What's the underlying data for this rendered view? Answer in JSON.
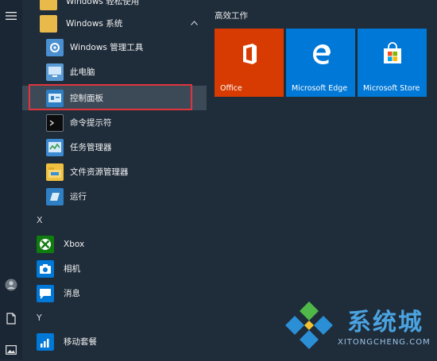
{
  "list": {
    "cut_top_label": "Windows 轻松使用",
    "group": {
      "label": "Windows 系统",
      "chevron": "up"
    },
    "items": [
      {
        "label": "Windows 管理工具",
        "icon": "admin-tools-icon"
      },
      {
        "label": "此电脑",
        "icon": "this-pc-icon"
      },
      {
        "label": "控制面板",
        "icon": "control-panel-icon",
        "selected": true
      },
      {
        "label": "命令提示符",
        "icon": "cmd-icon"
      },
      {
        "label": "任务管理器",
        "icon": "task-manager-icon"
      },
      {
        "label": "文件资源管理器",
        "icon": "file-explorer-icon"
      },
      {
        "label": "运行",
        "icon": "run-icon"
      }
    ],
    "letter_x": "X",
    "x_items": [
      {
        "label": "Xbox",
        "icon": "xbox-icon"
      },
      {
        "label": "相机",
        "icon": "camera-icon"
      },
      {
        "label": "消息",
        "icon": "messaging-icon"
      }
    ],
    "letter_y": "Y",
    "y_items": [
      {
        "label": "移动套餐",
        "icon": "mobile-plans-icon"
      }
    ]
  },
  "tiles": {
    "group_title": "高效工作",
    "items": [
      {
        "label": "Office",
        "color": "#d83b01",
        "icon": "office-icon"
      },
      {
        "label": "Microsoft Edge",
        "color": "#0078d7",
        "icon": "edge-icon"
      },
      {
        "label": "Microsoft Store",
        "color": "#0078d7",
        "icon": "store-icon"
      }
    ]
  },
  "watermark": {
    "brand": "系统城",
    "url": "XITONGCHENG.COM"
  },
  "colors": {
    "background": "#1f2c3a",
    "highlight_border": "#e0343c",
    "accent_blue": "#0078d7"
  }
}
